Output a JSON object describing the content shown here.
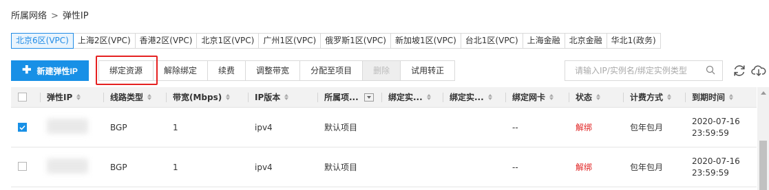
{
  "breadcrumb": {
    "parent": "所属网络",
    "separator": ">",
    "current": "弹性IP"
  },
  "regions": [
    "北京6区(VPC)",
    "上海2区(VPC)",
    "香港2区(VPC)",
    "北京1区(VPC)",
    "广州1区(VPC)",
    "俄罗斯1区(VPC)",
    "新加坡1区(VPC)",
    "台北1区(VPC)",
    "上海金融",
    "北京金融",
    "华北1(政务)"
  ],
  "active_region": "北京6区(VPC)",
  "toolbar": {
    "create_label": "新建弹性IP",
    "actions": [
      "绑定资源",
      "解除绑定",
      "续费",
      "调整带宽",
      "分配至项目",
      "删除",
      "试用转正"
    ],
    "disabled_action": "删除",
    "highlighted_action": "绑定资源"
  },
  "search": {
    "placeholder": "请输入IP/实例名/绑定实例类型"
  },
  "table": {
    "columns": [
      "弹性IP",
      "线路类型",
      "带宽(Mbps)",
      "IP版本",
      "所属项...",
      "绑定实...",
      "绑定实...",
      "绑定网卡",
      "状态",
      "计费方式",
      "到期时间"
    ],
    "rows": [
      {
        "checked": true,
        "ip": "",
        "line": "BGP",
        "bandwidth": "1",
        "ip_version": "ipv4",
        "project": "默认项目",
        "bind_instance": "",
        "bind_instance_type": "",
        "nic": "--",
        "status": "解绑",
        "billing": "包年包月",
        "expiry_date": "2020-07-16",
        "expiry_time": "23:59:59"
      },
      {
        "checked": false,
        "ip": "",
        "line": "BGP",
        "bandwidth": "1",
        "ip_version": "ipv4",
        "project": "默认项目",
        "bind_instance": "",
        "bind_instance_type": "",
        "nic": "--",
        "status": "解绑",
        "billing": "包年包月",
        "expiry_date": "2020-07-16",
        "expiry_time": "23:59:59"
      }
    ]
  },
  "colors": {
    "accent": "#1890e6",
    "status_red": "#e02020",
    "highlight_red": "#e52020"
  }
}
